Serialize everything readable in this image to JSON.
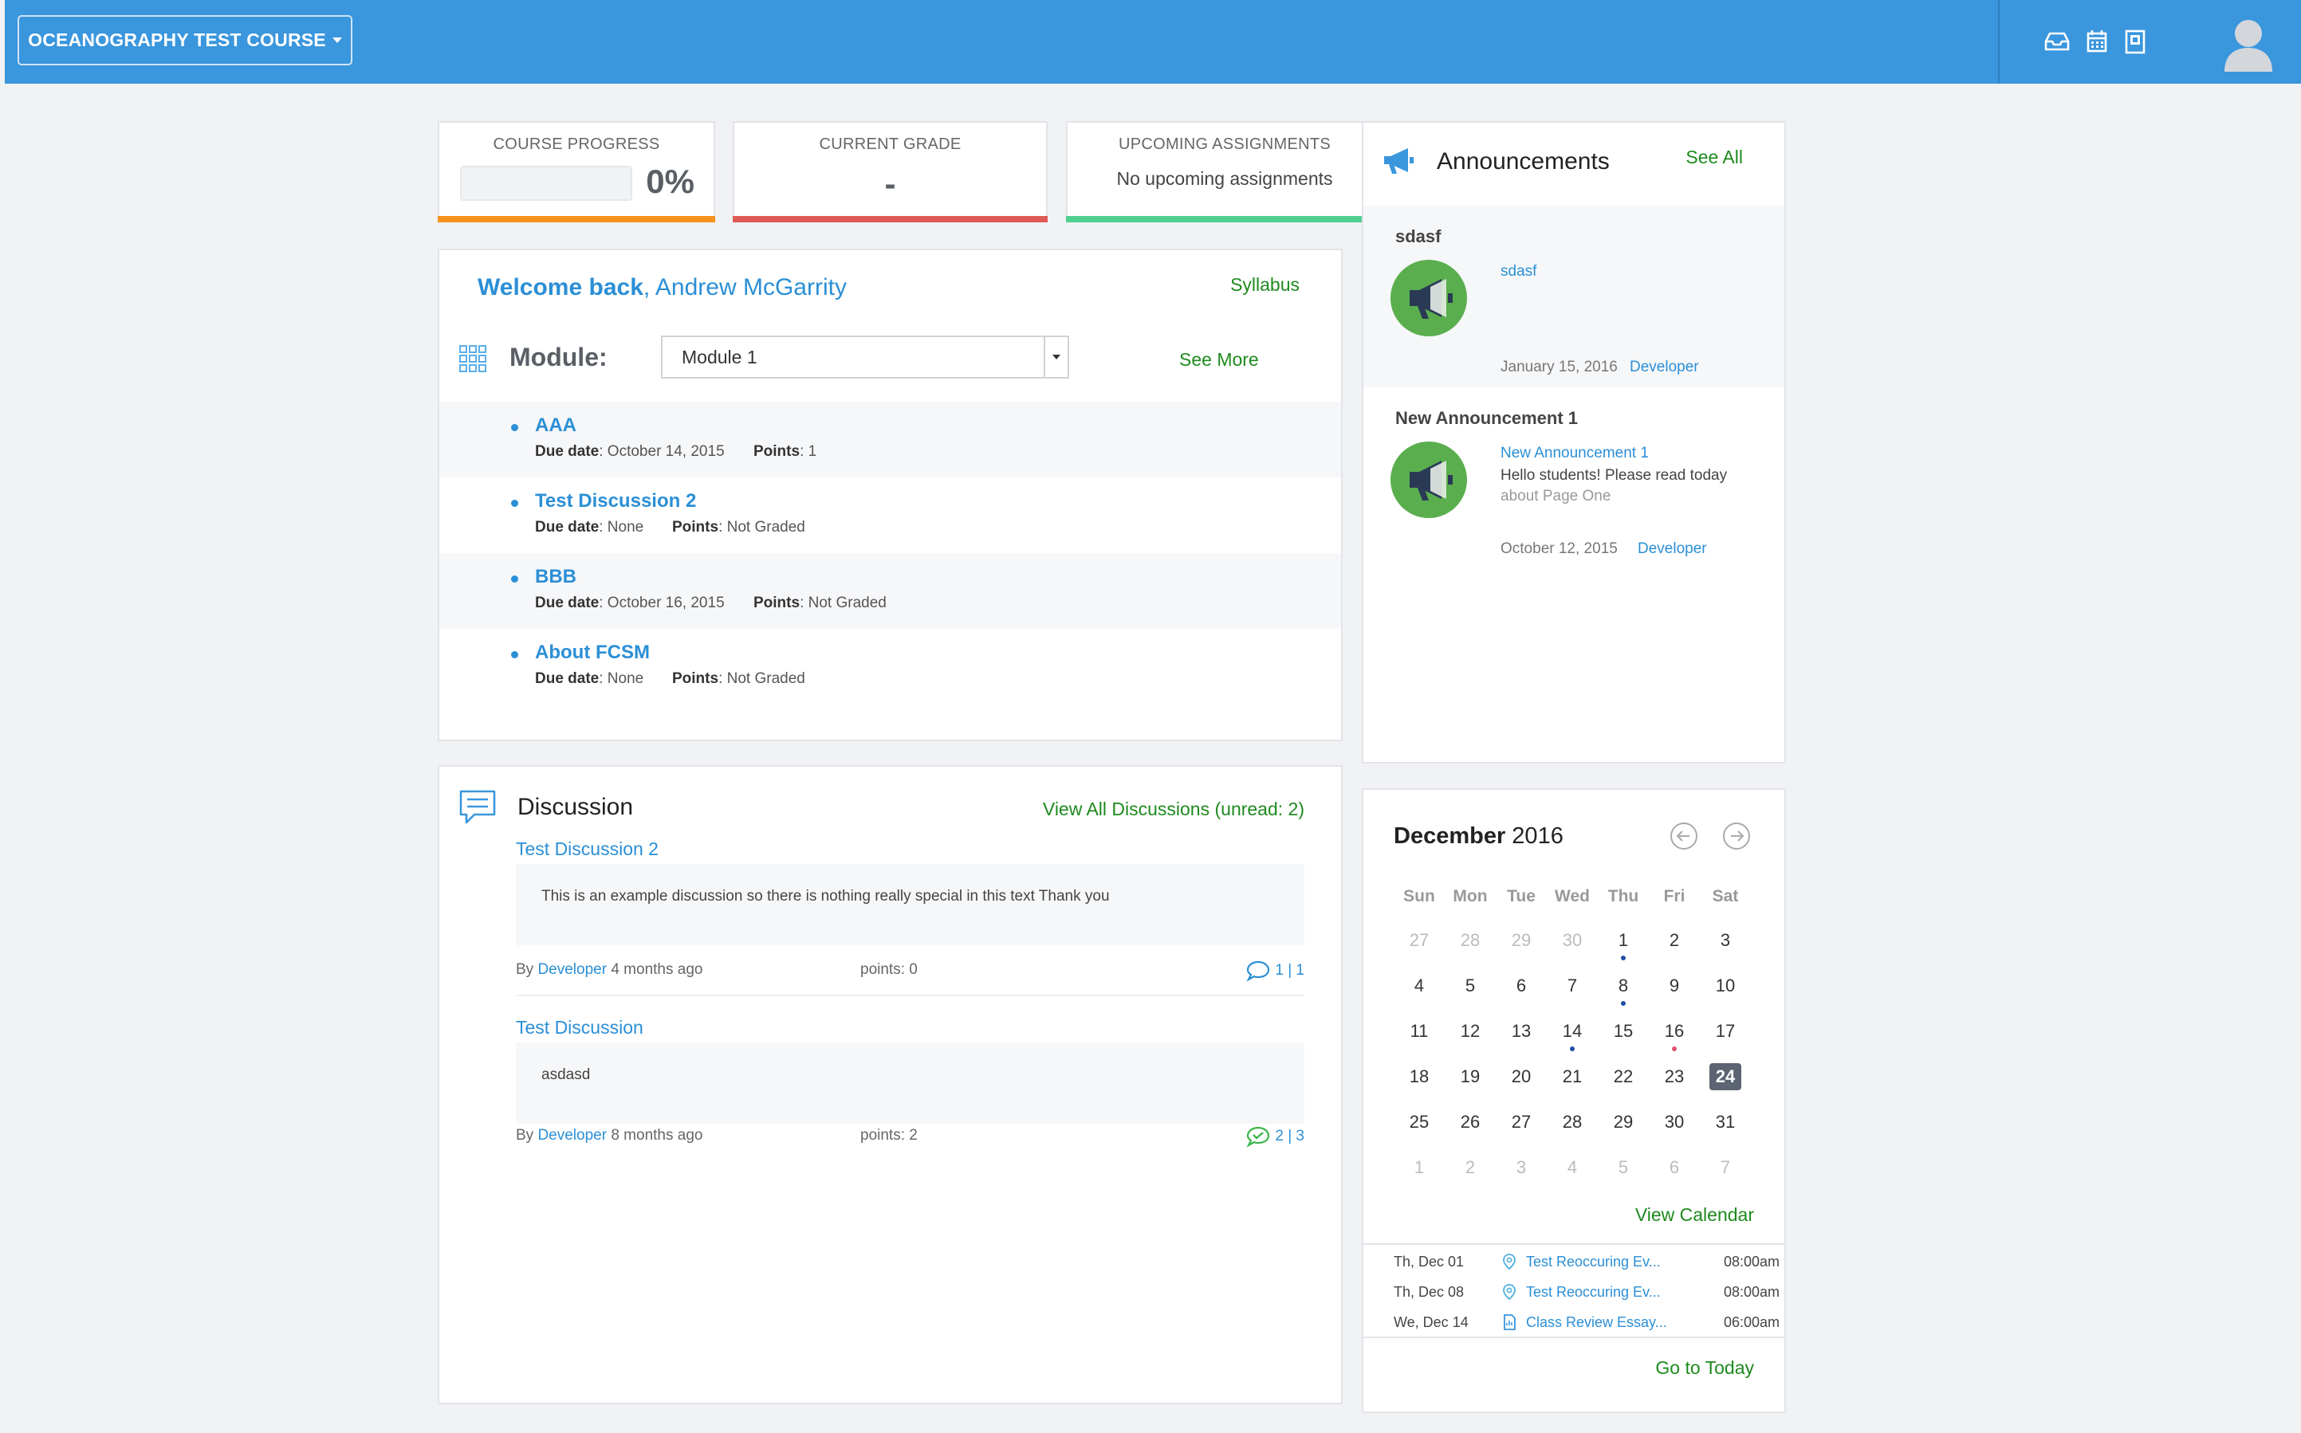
{
  "topbar": {
    "course_label": "OCEANOGRAPHY TEST COURSE",
    "icons": [
      "inbox-icon",
      "calendar-icon",
      "grades-icon"
    ],
    "avatar": "user-avatar-icon"
  },
  "stats": {
    "progress": {
      "label": "COURSE PROGRESS",
      "value": "0%",
      "fraction": 0,
      "color": "#f6931e"
    },
    "grade": {
      "label": "CURRENT GRADE",
      "value": "-",
      "color": "#e05a55"
    },
    "upcoming": {
      "label": "UPCOMING ASSIGNMENTS",
      "value": "No upcoming assignments",
      "color": "#4fcf8f"
    }
  },
  "welcome": {
    "greeting": "Welcome back",
    "name": ", Andrew McGarrity",
    "syllabus_label": "Syllabus",
    "module_label": "Module:",
    "module_selected": "Module 1",
    "see_more_label": "See More",
    "due_label": "Due date",
    "points_label": "Points",
    "items": [
      {
        "title": "AAA",
        "due": ": October 14, 2015",
        "points": ": 1"
      },
      {
        "title": "Test Discussion 2",
        "due": ": None",
        "points": ": Not Graded"
      },
      {
        "title": "BBB",
        "due": ": October 16, 2015",
        "points": ": Not Graded"
      },
      {
        "title": "About FCSM",
        "due": ": None",
        "points": ": Not Graded"
      }
    ]
  },
  "discussion": {
    "title": "Discussion",
    "view_all_label": "View All Discussions (unread: 2)",
    "items": [
      {
        "title": "Test Discussion 2",
        "body": "This is an example discussion so there is nothing really special in this text Thank you",
        "by": "By ",
        "author": "Developer",
        "ago": " 4 months ago",
        "points": "points: 0",
        "count": "1 | 1"
      },
      {
        "title": "Test Discussion",
        "body": "asdasd",
        "by": "By ",
        "author": "Developer",
        "ago": " 8 months ago",
        "points": "points: 2",
        "count": "2 | 3"
      }
    ]
  },
  "announcements": {
    "title": "Announcements",
    "see_all_label": "See All",
    "items": [
      {
        "name": "sdasf",
        "link": "sdasf",
        "text": "",
        "text_fade": "",
        "date": "January 15, 2016",
        "author": "Developer"
      },
      {
        "name": "New Announcement 1",
        "link": "New Announcement 1",
        "text": "Hello students! Please read today",
        "text_fade": "about Page One",
        "date": "October 12, 2015",
        "author": "Developer"
      }
    ]
  },
  "calendar": {
    "month": "December",
    "year": " 2016",
    "weekdays": [
      "Sun",
      "Mon",
      "Tue",
      "Wed",
      "Thu",
      "Fri",
      "Sat"
    ],
    "weeks": [
      [
        "27",
        "28",
        "29",
        "30",
        "1",
        "2",
        "3"
      ],
      [
        "4",
        "5",
        "6",
        "7",
        "8",
        "9",
        "10"
      ],
      [
        "11",
        "12",
        "13",
        "14",
        "15",
        "16",
        "17"
      ],
      [
        "18",
        "19",
        "20",
        "21",
        "22",
        "23",
        "24"
      ],
      [
        "25",
        "26",
        "27",
        "28",
        "29",
        "30",
        "31"
      ],
      [
        "1",
        "2",
        "3",
        "4",
        "5",
        "6",
        "7"
      ]
    ],
    "today": "24",
    "view_calendar_label": "View Calendar",
    "go_today_label": "Go to Today",
    "events": [
      {
        "day": "Th, Dec 01",
        "icon": "location-pin-icon",
        "name": "Test Reoccuring Ev...",
        "time": "08:00am"
      },
      {
        "day": "Th, Dec 08",
        "icon": "location-pin-icon",
        "name": "Test Reoccuring Ev...",
        "time": "08:00am"
      },
      {
        "day": "We, Dec 14",
        "icon": "document-icon",
        "name": "Class Review Essay...",
        "time": "06:00am"
      }
    ]
  }
}
